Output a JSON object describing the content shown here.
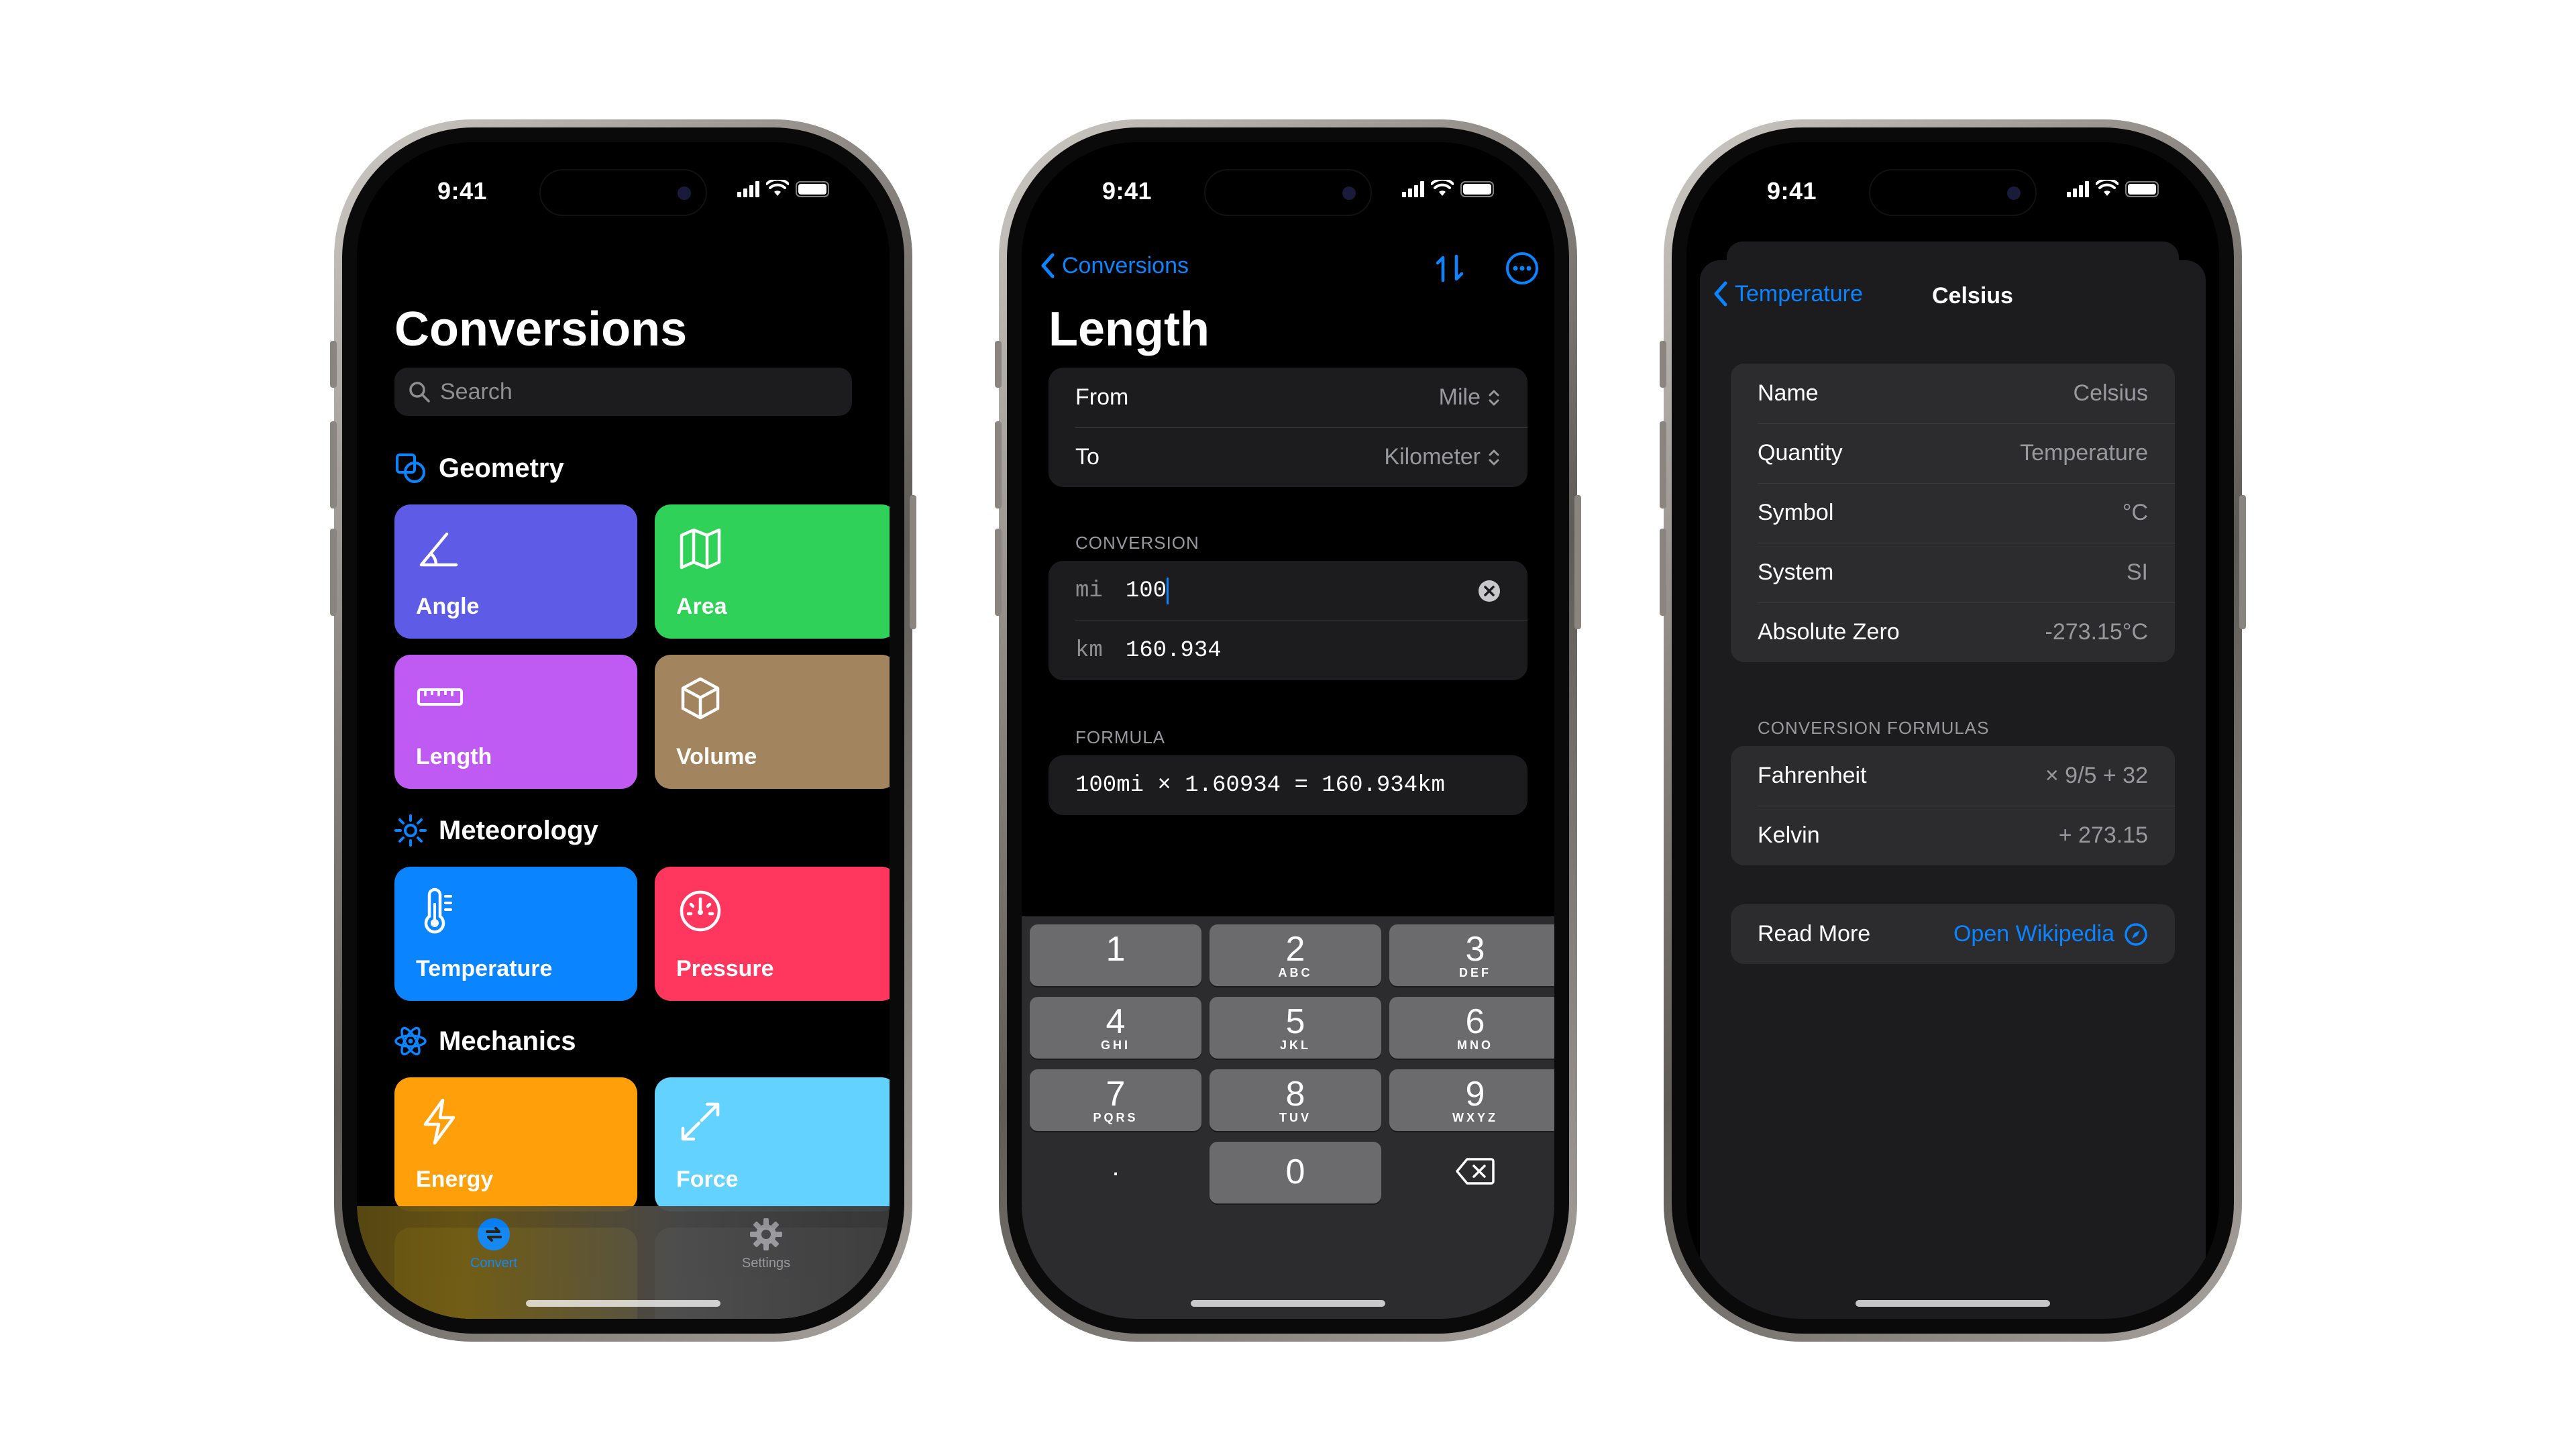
{
  "status_time": "9:41",
  "phone1": {
    "title": "Conversions",
    "search_placeholder": "Search",
    "sections": [
      {
        "name": "Geometry",
        "tiles": [
          {
            "label": "Angle",
            "color": "#5e5ce6"
          },
          {
            "label": "Area",
            "color": "#30d158"
          },
          {
            "label": "Length",
            "color": "#bf5af2"
          },
          {
            "label": "Volume",
            "color": "#a2845e"
          }
        ]
      },
      {
        "name": "Meteorology",
        "tiles": [
          {
            "label": "Temperature",
            "color": "#0a84ff"
          },
          {
            "label": "Pressure",
            "color": "#ff375f"
          }
        ]
      },
      {
        "name": "Mechanics",
        "tiles": [
          {
            "label": "Energy",
            "color": "#ff9f0a"
          },
          {
            "label": "Force",
            "color": "#64d2ff"
          }
        ]
      }
    ],
    "tabs": [
      {
        "label": "Convert",
        "active": true
      },
      {
        "label": "Settings",
        "active": false
      }
    ]
  },
  "phone2": {
    "back_label": "Conversions",
    "title": "Length",
    "from_label": "From",
    "from_value": "Mile",
    "to_label": "To",
    "to_value": "Kilometer",
    "conversion_header": "CONVERSION",
    "input_unit": "mi",
    "input_value": "100",
    "output_unit": "km",
    "output_value": "160.934",
    "formula_header": "FORMULA",
    "formula": "100mi × 1.60934 = 160.934km",
    "keys": [
      {
        "n": "1",
        "l": ""
      },
      {
        "n": "2",
        "l": "ABC"
      },
      {
        "n": "3",
        "l": "DEF"
      },
      {
        "n": "4",
        "l": "GHI"
      },
      {
        "n": "5",
        "l": "JKL"
      },
      {
        "n": "6",
        "l": "MNO"
      },
      {
        "n": "7",
        "l": "PQRS"
      },
      {
        "n": "8",
        "l": "TUV"
      },
      {
        "n": "9",
        "l": "WXYZ"
      },
      {
        "n": ".",
        "l": ""
      },
      {
        "n": "0",
        "l": ""
      }
    ]
  },
  "phone3": {
    "back_label": "Temperature",
    "title": "Celsius",
    "info": [
      {
        "label": "Name",
        "value": "Celsius"
      },
      {
        "label": "Quantity",
        "value": "Temperature"
      },
      {
        "label": "Symbol",
        "value": "°C"
      },
      {
        "label": "System",
        "value": "SI"
      },
      {
        "label": "Absolute Zero",
        "value": "-273.15°C"
      }
    ],
    "formulas_header": "CONVERSION FORMULAS",
    "formulas": [
      {
        "label": "Fahrenheit",
        "value": "× 9/5 + 32"
      },
      {
        "label": "Kelvin",
        "value": "+ 273.15"
      }
    ],
    "read_more_label": "Read More",
    "read_more_link": "Open Wikipedia"
  },
  "accent_color": "#0a84ff"
}
